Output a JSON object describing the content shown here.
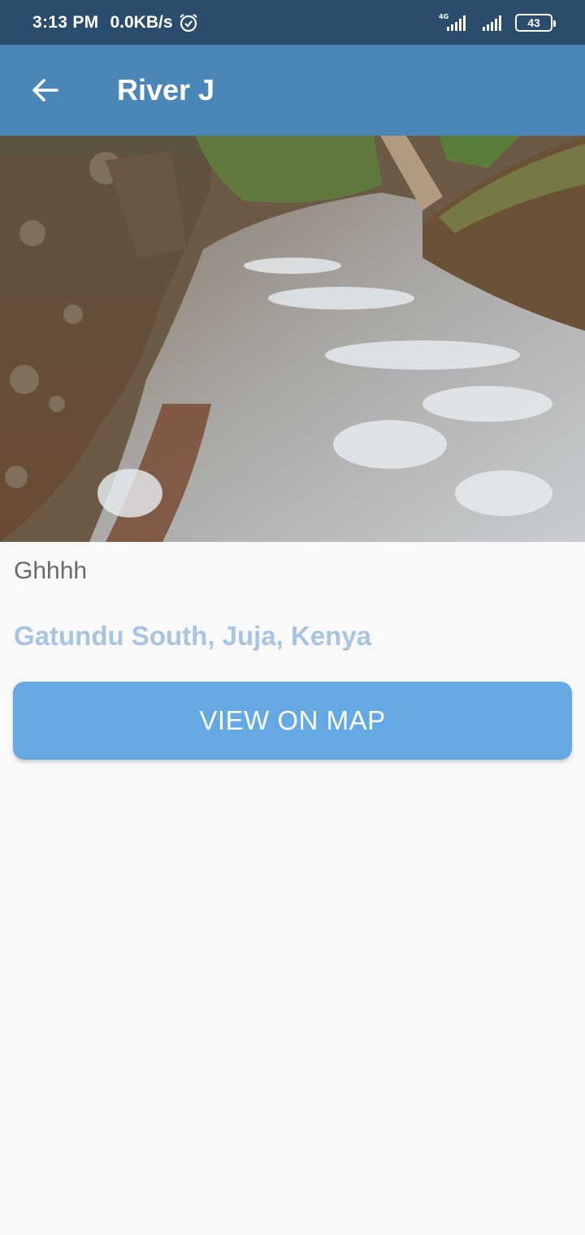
{
  "status_bar": {
    "time": "3:13 PM",
    "speed": "0.0KB/s",
    "network": "4G",
    "battery": "43"
  },
  "app_bar": {
    "title": "River J",
    "back_icon": "arrow-left-icon"
  },
  "details": {
    "description": "Ghhhh",
    "location": "Gatundu South, Juja, Kenya",
    "map_button_label": "VIEW ON MAP"
  },
  "colors": {
    "status_bar": "#2b4d6d",
    "app_bar": "#4a86b8",
    "button": "#64a9e3",
    "location_text": "#a7c4e0"
  }
}
